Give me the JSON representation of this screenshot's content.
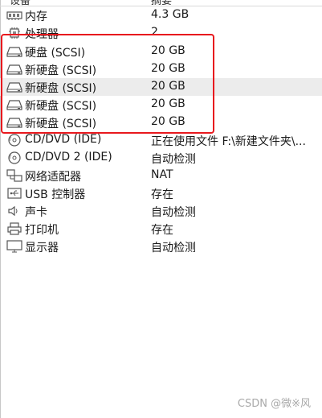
{
  "header": {
    "device": "设备",
    "summary": "摘要"
  },
  "rows": [
    {
      "label": "内存",
      "value": "4.3 GB",
      "icon": "memory-icon"
    },
    {
      "label": "处理器",
      "value": "2",
      "icon": "processor-icon"
    },
    {
      "label": "硬盘 (SCSI)",
      "value": "20 GB",
      "icon": "hard-disk-icon"
    },
    {
      "label": "新硬盘 (SCSI)",
      "value": "20 GB",
      "icon": "hard-disk-icon"
    },
    {
      "label": "新硬盘 (SCSI)",
      "value": "20 GB",
      "icon": "hard-disk-icon",
      "selected": true
    },
    {
      "label": "新硬盘 (SCSI)",
      "value": "20 GB",
      "icon": "hard-disk-icon"
    },
    {
      "label": "新硬盘 (SCSI)",
      "value": "20 GB",
      "icon": "hard-disk-icon"
    },
    {
      "label": "CD/DVD (IDE)",
      "value": "正在使用文件 F:\\新建文件夹\\...",
      "icon": "cd-dvd-icon"
    },
    {
      "label": "CD/DVD 2 (IDE)",
      "value": "自动检测",
      "icon": "cd-dvd-icon"
    },
    {
      "label": "网络适配器",
      "value": "NAT",
      "icon": "network-adapter-icon"
    },
    {
      "label": "USB 控制器",
      "value": "存在",
      "icon": "usb-icon"
    },
    {
      "label": "声卡",
      "value": "自动检测",
      "icon": "speaker-icon"
    },
    {
      "label": "打印机",
      "value": "存在",
      "icon": "printer-icon"
    },
    {
      "label": "显示器",
      "value": "自动检测",
      "icon": "monitor-icon"
    }
  ],
  "watermark": "CSDN @微※风",
  "colors": {
    "highlight_border": "#e8191e",
    "selected_row": "#ececec"
  }
}
